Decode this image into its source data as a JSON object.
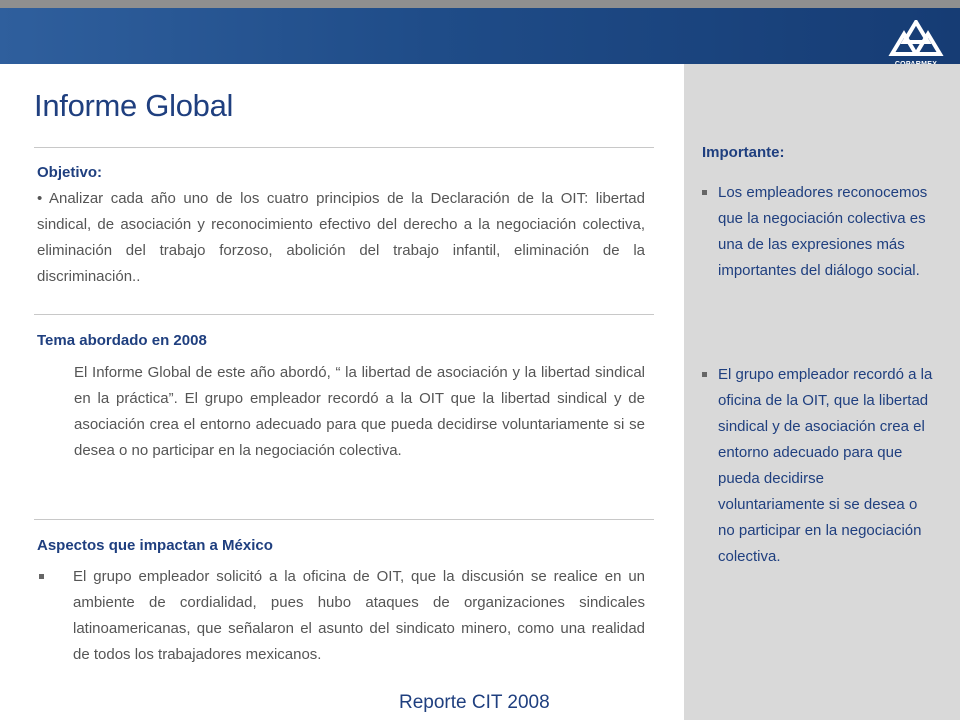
{
  "header": {
    "logo_text": "COPARMEX",
    "brand_color": "#1f4c88"
  },
  "page_title": "Informe Global",
  "objetivo": {
    "heading": "Objetivo:",
    "text": "• Analizar cada año uno de los cuatro principios de la Declaración de la OIT: libertad sindical,  de asociación y reconocimiento  efectivo del derecho a la negociación colectiva, eliminación del trabajo forzoso, abolición del trabajo infantil, eliminación de la discriminación.."
  },
  "tema": {
    "heading": "Tema abordado en 2008",
    "text": "El Informe Global de este año abordó, “ la libertad de asociación y la libertad sindical en la práctica”. El grupo empleador  recordó a la OIT que la libertad sindical y de asociación  crea el entorno adecuado para que pueda decidirse voluntariamente si se desea o no participar en la negociación colectiva."
  },
  "aspectos": {
    "heading": "Aspectos que impactan a México",
    "items": [
      "El grupo empleador solicitó a la oficina de OIT, que la discusión se realice en un ambiente de cordialidad, pues hubo ataques de organizaciones sindicales latinoamericanas, que señalaron el asunto del sindicato minero, como una realidad de todos los trabajadores mexicanos."
    ]
  },
  "sidebar": {
    "heading": "Importante:",
    "items": [
      "Los empleadores reconocemos que la negociación colectiva es una de las expresiones más importantes del diálogo social.",
      "El grupo empleador recordó a la oficina de la OIT, que la libertad sindical y de asociación crea el entorno adecuado para que pueda decidirse voluntariamente si se desea o no participar en la negociación colectiva."
    ]
  },
  "footer": "Reporte CIT 2008"
}
